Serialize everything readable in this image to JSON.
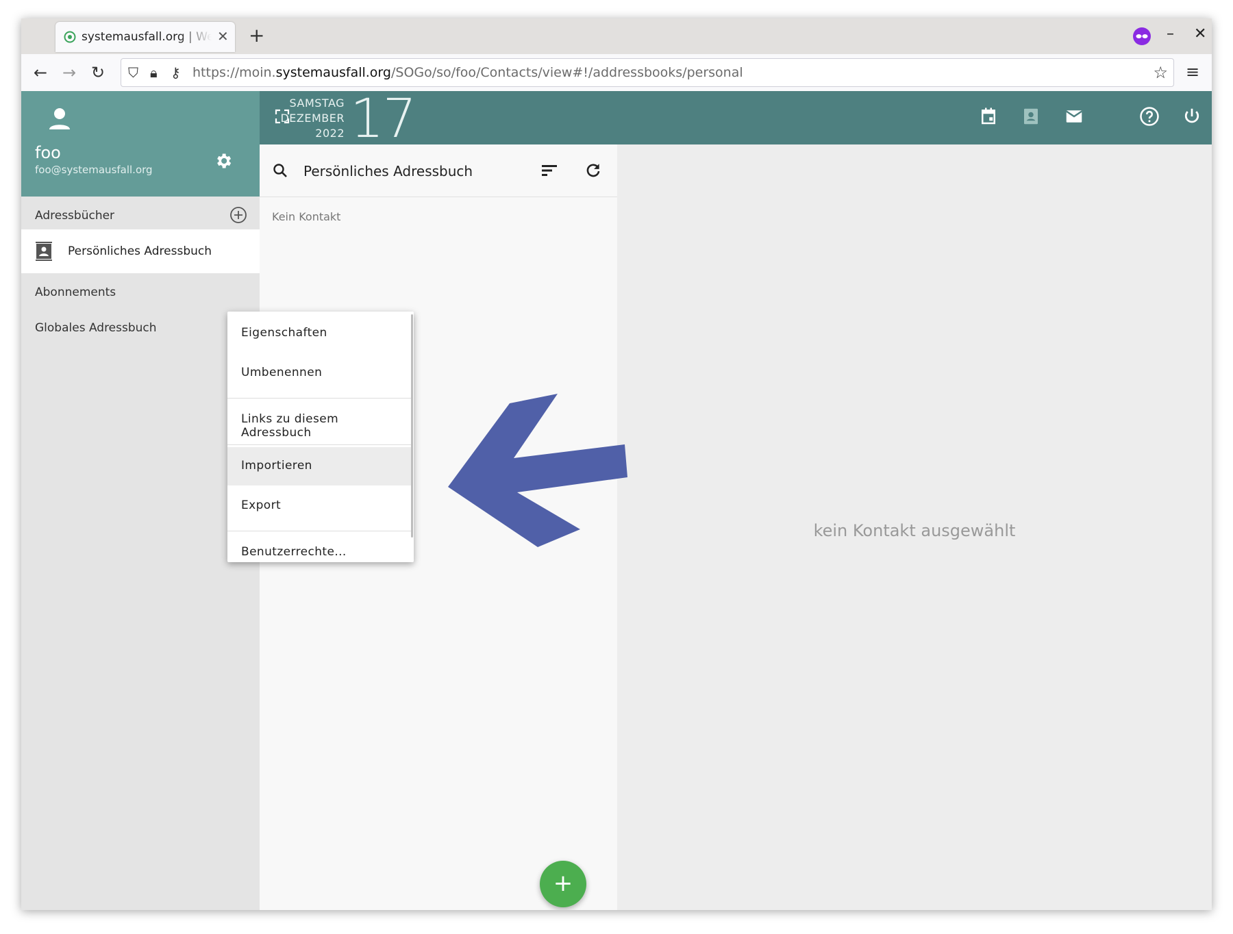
{
  "browser": {
    "tab_title": "systemausfall.org | Webmail",
    "url_prefix": "https://moin.",
    "url_domain": "systemausfall.org",
    "url_path": "/SOGo/so/foo/Contacts/view#!/addressbooks/personal"
  },
  "user": {
    "name": "foo",
    "email": "foo@systemausfall.org"
  },
  "date": {
    "weekday": "SAMSTAG",
    "month": "DEZEMBER",
    "year": "2022",
    "day": "17"
  },
  "sidebar": {
    "heading": "Adressbücher",
    "active_item": "Persönliches Adressbuch",
    "items": [
      "Abonnements",
      "Globales Adressbuch"
    ]
  },
  "list": {
    "title": "Persönliches Adressbuch",
    "empty_text": "Kein Kontakt"
  },
  "detail": {
    "empty_text": "kein Kontakt ausgewählt"
  },
  "context_menu": {
    "items": [
      "Eigenschaften",
      "Umbenennen",
      "Links zu diesem Adressbuch",
      "Importieren",
      "Export",
      "Benutzerrechte..."
    ]
  },
  "fab": {
    "label": "+"
  },
  "colors": {
    "header": "#4e8080",
    "user_panel": "#649c98",
    "fab": "#4cae4f",
    "annotation_arrow": "#5060a8"
  }
}
